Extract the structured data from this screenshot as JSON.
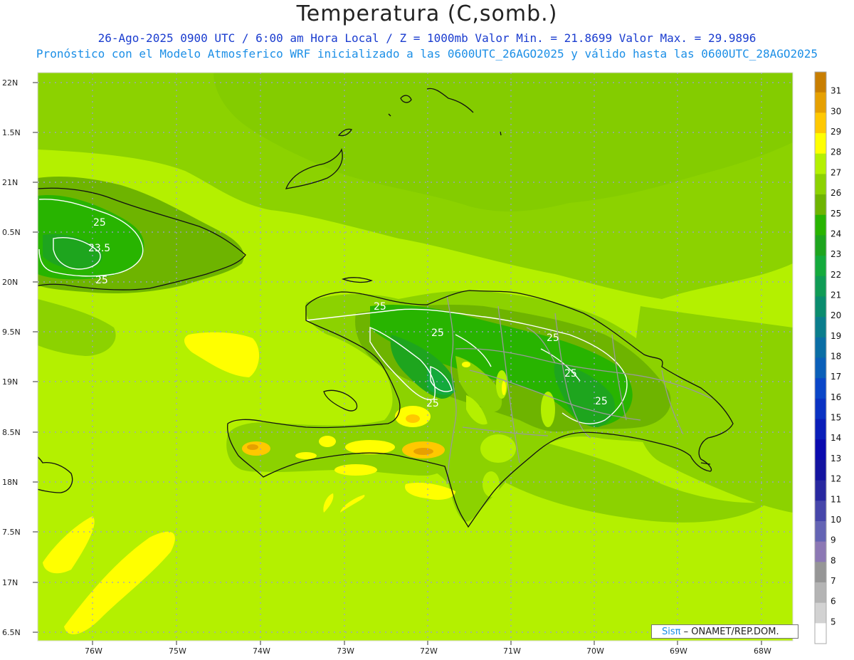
{
  "header": {
    "title": "Temperatura (C,somb.)",
    "line1": "26-Ago-2025  0900 UTC / 6:00 am Hora Local / Z = 1000mb   Valor Min. = 21.8699  Valor Max. = 29.9896",
    "line2": "Pronóstico con el Modelo Atmosferico WRF inicializado a las 0600UTC_26AGO2025 y válido hasta las  0600UTC_28AGO2025"
  },
  "axes": {
    "lat_labels": [
      "22N",
      "1.5N",
      "21N",
      "0.5N",
      "20N",
      "9.5N",
      "19N",
      "8.5N",
      "18N",
      "7.5N",
      "17N",
      "6.5N"
    ],
    "lon_labels": [
      "76W",
      "75W",
      "74W",
      "73W",
      "72W",
      "71W",
      "70W",
      "69W",
      "68W"
    ]
  },
  "contour_labels": [
    "25",
    "23.5",
    "25",
    "25",
    "25",
    "25",
    "25",
    "25",
    "25"
  ],
  "colorbar": {
    "levels": [
      "31",
      "30",
      "29",
      "28",
      "27",
      "26",
      "25",
      "24",
      "23",
      "22",
      "21",
      "20",
      "19",
      "18",
      "17",
      "16",
      "15",
      "14",
      "13",
      "12",
      "11",
      "10",
      "9",
      "8",
      "7",
      "6",
      "5"
    ],
    "colors": [
      "#c87e00",
      "#e6a000",
      "#ffc800",
      "#ffff00",
      "#b4f000",
      "#8cd200",
      "#6eb400",
      "#28b400",
      "#1ea51e",
      "#14aa3c",
      "#0f9b55",
      "#0a8c6e",
      "#0a7d8c",
      "#0a6ea5",
      "#0a5fb9",
      "#0a46c8",
      "#0a32c3",
      "#0a1eb9",
      "#0a0aaf",
      "#1414a0",
      "#2828a0",
      "#4646aa",
      "#6464b4",
      "#8c78b4",
      "#969696",
      "#b4b4b4",
      "#d2d2d2",
      "#ffffff"
    ]
  },
  "credit": {
    "sis": "Sisπ",
    "text": "– ONAMET/REP.DOM."
  }
}
